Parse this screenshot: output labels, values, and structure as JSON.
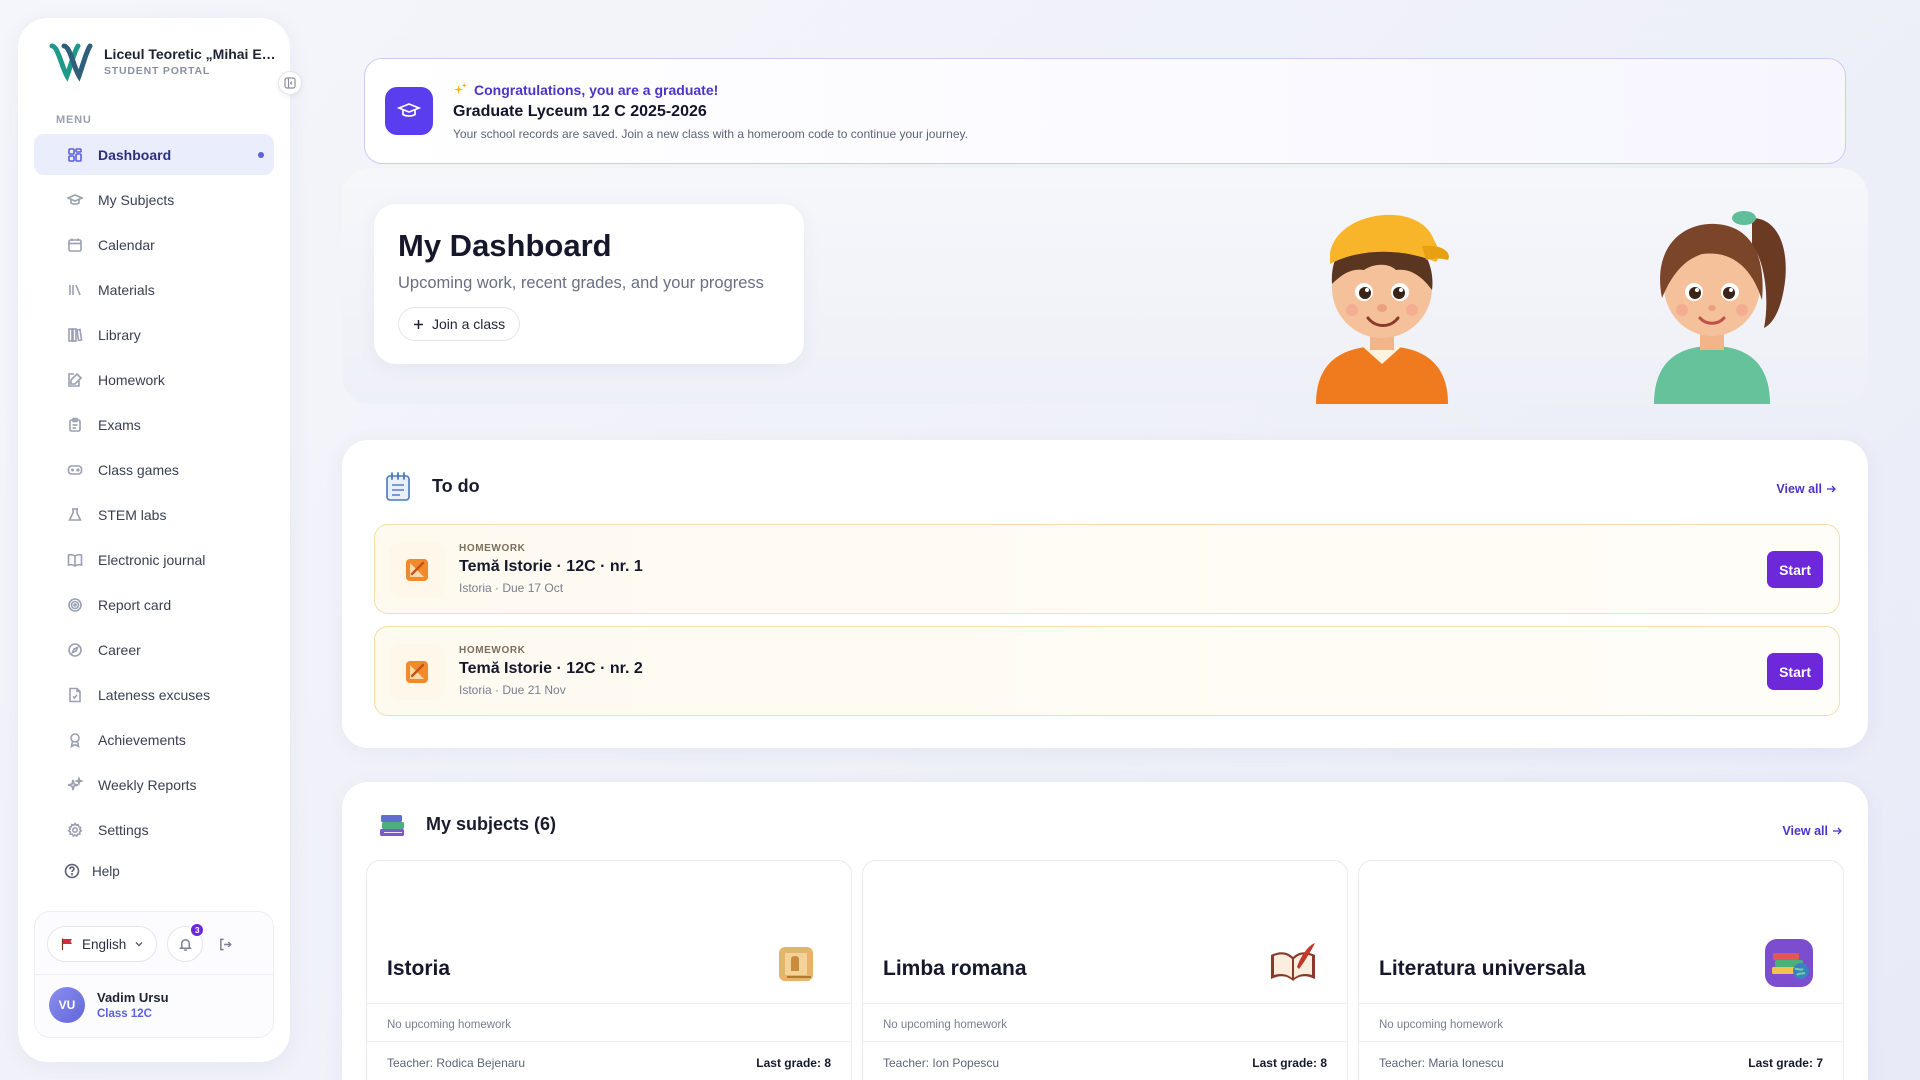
{
  "brand": {
    "name": "Liceul Teoretic „Mihai Eminescu\"",
    "subtitle": "STUDENT PORTAL"
  },
  "sidebar": {
    "menu_label": "MENU",
    "items": [
      {
        "label": "Dashboard",
        "icon": "grid-icon"
      },
      {
        "label": "My Subjects",
        "icon": "graduation-cap-icon"
      },
      {
        "label": "Calendar",
        "icon": "calendar-icon"
      },
      {
        "label": "Materials",
        "icon": "materials-icon"
      },
      {
        "label": "Library",
        "icon": "library-icon"
      },
      {
        "label": "Homework",
        "icon": "edit-note-icon"
      },
      {
        "label": "Exams",
        "icon": "clipboard-icon"
      },
      {
        "label": "Class games",
        "icon": "gamepad-icon"
      },
      {
        "label": "STEM labs",
        "icon": "flask-icon"
      },
      {
        "label": "Electronic journal",
        "icon": "book-open-icon"
      },
      {
        "label": "Report card",
        "icon": "target-icon"
      },
      {
        "label": "Career",
        "icon": "compass-icon"
      },
      {
        "label": "Lateness excuses",
        "icon": "document-icon"
      },
      {
        "label": "Achievements",
        "icon": "medal-icon"
      },
      {
        "label": "Weekly Reports",
        "icon": "sparkles-icon"
      },
      {
        "label": "Settings",
        "icon": "gear-icon"
      }
    ],
    "help_label": "Help",
    "language": "English",
    "notifications_count": "3",
    "user": {
      "initials": "VU",
      "name": "Vadim Ursu",
      "class": "Class 12C"
    }
  },
  "banner": {
    "kicker": "Congratulations, you are a graduate!",
    "title": "Graduate Lyceum 12 C 2025-2026",
    "description": "Your school records are saved. Join a new class with a homeroom code to continue your journey."
  },
  "hero": {
    "title": "My Dashboard",
    "subtitle": "Upcoming work, recent grades, and your progress",
    "join_label": "Join a class"
  },
  "todo": {
    "title": "To do",
    "view_all": "View all",
    "items": [
      {
        "kicker": "HOMEWORK",
        "title": "Temă Istorie · 12C · nr. 1",
        "meta": "Istoria · Due 17 Oct",
        "button": "Start"
      },
      {
        "kicker": "HOMEWORK",
        "title": "Temă Istorie · 12C · nr. 2",
        "meta": "Istoria · Due 21 Nov",
        "button": "Start"
      }
    ]
  },
  "subjects": {
    "title": "My subjects (6)",
    "view_all": "View all",
    "items": [
      {
        "name": "Istoria",
        "homework": "No upcoming homework",
        "teacher": "Teacher: Rodica Bejenaru",
        "grade": "Last grade: 8"
      },
      {
        "name": "Limba romana",
        "homework": "No upcoming homework",
        "teacher": "Teacher: Ion Popescu",
        "grade": "Last grade: 8"
      },
      {
        "name": "Literatura universala",
        "homework": "No upcoming homework",
        "teacher": "Teacher: Maria Ionescu",
        "grade": "Last grade: 7"
      }
    ]
  },
  "colors": {
    "accent": "#5b5fe0",
    "primary_button": "#6d28d9",
    "banner_icon": "#5b3df0",
    "todo_border": "#f6dfa8"
  }
}
